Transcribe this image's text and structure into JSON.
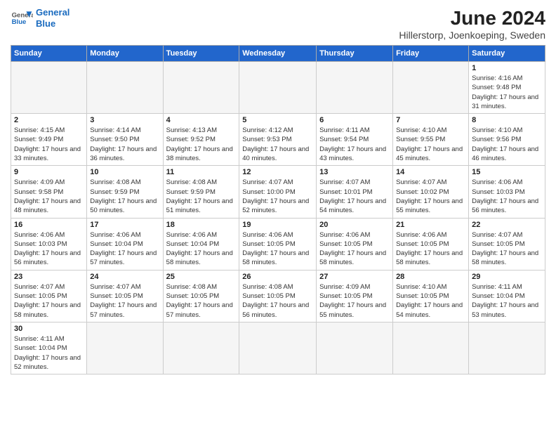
{
  "header": {
    "logo_general": "General",
    "logo_blue": "Blue",
    "title": "June 2024",
    "location": "Hillerstorp, Joenkoeping, Sweden"
  },
  "weekdays": [
    "Sunday",
    "Monday",
    "Tuesday",
    "Wednesday",
    "Thursday",
    "Friday",
    "Saturday"
  ],
  "weeks": [
    [
      {
        "day": "",
        "info": ""
      },
      {
        "day": "",
        "info": ""
      },
      {
        "day": "",
        "info": ""
      },
      {
        "day": "",
        "info": ""
      },
      {
        "day": "",
        "info": ""
      },
      {
        "day": "",
        "info": ""
      },
      {
        "day": "1",
        "info": "Sunrise: 4:16 AM\nSunset: 9:48 PM\nDaylight: 17 hours and 31 minutes."
      }
    ],
    [
      {
        "day": "2",
        "info": "Sunrise: 4:15 AM\nSunset: 9:49 PM\nDaylight: 17 hours and 33 minutes."
      },
      {
        "day": "3",
        "info": "Sunrise: 4:14 AM\nSunset: 9:50 PM\nDaylight: 17 hours and 36 minutes."
      },
      {
        "day": "4",
        "info": "Sunrise: 4:13 AM\nSunset: 9:52 PM\nDaylight: 17 hours and 38 minutes."
      },
      {
        "day": "5",
        "info": "Sunrise: 4:12 AM\nSunset: 9:53 PM\nDaylight: 17 hours and 40 minutes."
      },
      {
        "day": "6",
        "info": "Sunrise: 4:11 AM\nSunset: 9:54 PM\nDaylight: 17 hours and 43 minutes."
      },
      {
        "day": "7",
        "info": "Sunrise: 4:10 AM\nSunset: 9:55 PM\nDaylight: 17 hours and 45 minutes."
      },
      {
        "day": "8",
        "info": "Sunrise: 4:10 AM\nSunset: 9:56 PM\nDaylight: 17 hours and 46 minutes."
      }
    ],
    [
      {
        "day": "9",
        "info": "Sunrise: 4:09 AM\nSunset: 9:58 PM\nDaylight: 17 hours and 48 minutes."
      },
      {
        "day": "10",
        "info": "Sunrise: 4:08 AM\nSunset: 9:59 PM\nDaylight: 17 hours and 50 minutes."
      },
      {
        "day": "11",
        "info": "Sunrise: 4:08 AM\nSunset: 9:59 PM\nDaylight: 17 hours and 51 minutes."
      },
      {
        "day": "12",
        "info": "Sunrise: 4:07 AM\nSunset: 10:00 PM\nDaylight: 17 hours and 52 minutes."
      },
      {
        "day": "13",
        "info": "Sunrise: 4:07 AM\nSunset: 10:01 PM\nDaylight: 17 hours and 54 minutes."
      },
      {
        "day": "14",
        "info": "Sunrise: 4:07 AM\nSunset: 10:02 PM\nDaylight: 17 hours and 55 minutes."
      },
      {
        "day": "15",
        "info": "Sunrise: 4:06 AM\nSunset: 10:03 PM\nDaylight: 17 hours and 56 minutes."
      }
    ],
    [
      {
        "day": "16",
        "info": "Sunrise: 4:06 AM\nSunset: 10:03 PM\nDaylight: 17 hours and 56 minutes."
      },
      {
        "day": "17",
        "info": "Sunrise: 4:06 AM\nSunset: 10:04 PM\nDaylight: 17 hours and 57 minutes."
      },
      {
        "day": "18",
        "info": "Sunrise: 4:06 AM\nSunset: 10:04 PM\nDaylight: 17 hours and 58 minutes."
      },
      {
        "day": "19",
        "info": "Sunrise: 4:06 AM\nSunset: 10:05 PM\nDaylight: 17 hours and 58 minutes."
      },
      {
        "day": "20",
        "info": "Sunrise: 4:06 AM\nSunset: 10:05 PM\nDaylight: 17 hours and 58 minutes."
      },
      {
        "day": "21",
        "info": "Sunrise: 4:06 AM\nSunset: 10:05 PM\nDaylight: 17 hours and 58 minutes."
      },
      {
        "day": "22",
        "info": "Sunrise: 4:07 AM\nSunset: 10:05 PM\nDaylight: 17 hours and 58 minutes."
      }
    ],
    [
      {
        "day": "23",
        "info": "Sunrise: 4:07 AM\nSunset: 10:05 PM\nDaylight: 17 hours and 58 minutes."
      },
      {
        "day": "24",
        "info": "Sunrise: 4:07 AM\nSunset: 10:05 PM\nDaylight: 17 hours and 57 minutes."
      },
      {
        "day": "25",
        "info": "Sunrise: 4:08 AM\nSunset: 10:05 PM\nDaylight: 17 hours and 57 minutes."
      },
      {
        "day": "26",
        "info": "Sunrise: 4:08 AM\nSunset: 10:05 PM\nDaylight: 17 hours and 56 minutes."
      },
      {
        "day": "27",
        "info": "Sunrise: 4:09 AM\nSunset: 10:05 PM\nDaylight: 17 hours and 55 minutes."
      },
      {
        "day": "28",
        "info": "Sunrise: 4:10 AM\nSunset: 10:05 PM\nDaylight: 17 hours and 54 minutes."
      },
      {
        "day": "29",
        "info": "Sunrise: 4:11 AM\nSunset: 10:04 PM\nDaylight: 17 hours and 53 minutes."
      }
    ],
    [
      {
        "day": "30",
        "info": "Sunrise: 4:11 AM\nSunset: 10:04 PM\nDaylight: 17 hours and 52 minutes."
      },
      {
        "day": "",
        "info": ""
      },
      {
        "day": "",
        "info": ""
      },
      {
        "day": "",
        "info": ""
      },
      {
        "day": "",
        "info": ""
      },
      {
        "day": "",
        "info": ""
      },
      {
        "day": "",
        "info": ""
      }
    ]
  ]
}
